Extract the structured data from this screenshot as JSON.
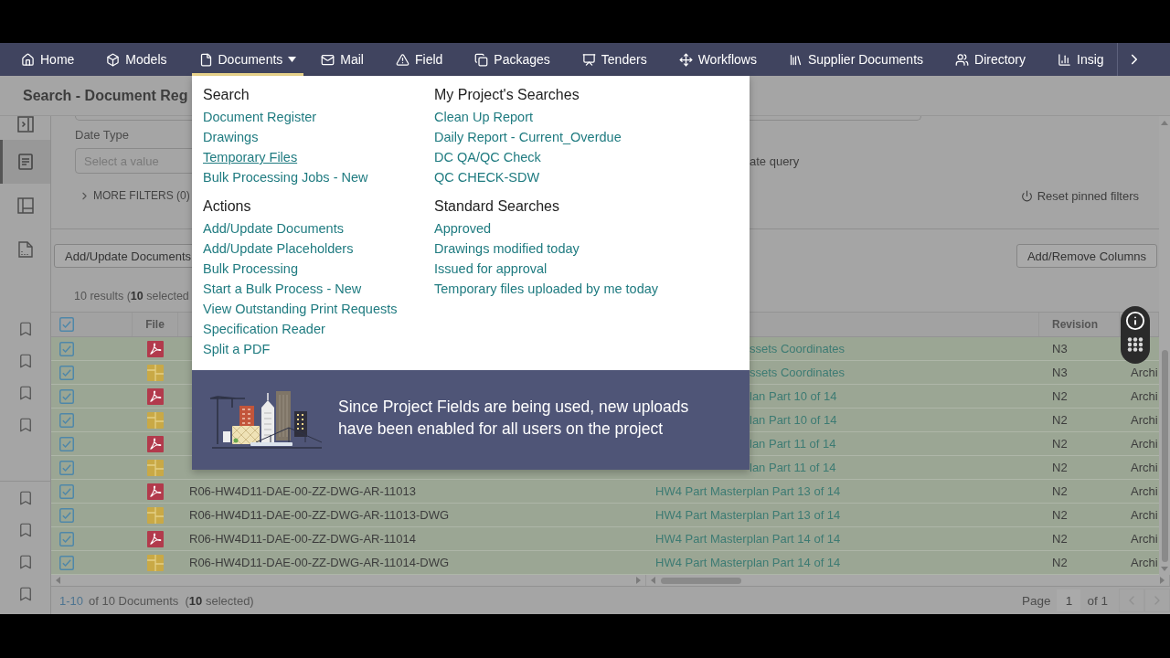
{
  "nav": {
    "items": [
      {
        "label": "Home",
        "selected": false,
        "dropdown": false
      },
      {
        "label": "Models",
        "selected": false,
        "dropdown": false
      },
      {
        "label": "Documents",
        "selected": true,
        "dropdown": true
      },
      {
        "label": "Mail",
        "selected": false,
        "dropdown": false
      },
      {
        "label": "Field",
        "selected": false,
        "dropdown": false
      },
      {
        "label": "Packages",
        "selected": false,
        "dropdown": false
      },
      {
        "label": "Tenders",
        "selected": false,
        "dropdown": false
      },
      {
        "label": "Workflows",
        "selected": false,
        "dropdown": false
      },
      {
        "label": "Supplier Documents",
        "selected": false,
        "dropdown": false
      },
      {
        "label": "Directory",
        "selected": false,
        "dropdown": false
      },
      {
        "label": "Insig",
        "selected": false,
        "dropdown": false
      }
    ]
  },
  "page_title": "Search - Document Reg",
  "sidebar": {
    "tools": [
      {
        "selected": true
      },
      {
        "selected": false
      },
      {
        "selected": false
      }
    ]
  },
  "filters": {
    "date_type": {
      "label": "Date Type",
      "placeholder": "Select a value"
    },
    "query_text": "ate query",
    "more_filters": {
      "label": "MORE FILTERS (0)",
      "expanded": false
    },
    "reset_button": "Reset pinned filters"
  },
  "toolbar": {
    "add_update_button": "Add/Update Documents",
    "columns_button": "Add/Remove Columns"
  },
  "results_summary": "10 results (**10** selected",
  "table": {
    "select_all": {
      "checked": true
    },
    "file_header": "File",
    "revision_header": "Revision",
    "rows": [
      {
        "selected": true,
        "kind": "pdf",
        "title": "ssets Coordinates",
        "revision": "N3"
      },
      {
        "selected": true,
        "kind": "dwg",
        "title": "ssets Coordinates",
        "revision": "N3",
        "discipline": "Archi"
      },
      {
        "selected": true,
        "kind": "pdf",
        "title": "lan Part 10 of 14",
        "revision": "N2",
        "discipline": "Archi"
      },
      {
        "selected": true,
        "kind": "dwg",
        "title": "lan Part 10 of 14",
        "revision": "N2",
        "discipline": "Archi"
      },
      {
        "selected": true,
        "kind": "pdf",
        "title": "lan Part 11 of 14",
        "revision": "N2",
        "discipline": "Archi"
      },
      {
        "selected": true,
        "kind": "dwg",
        "title": "lan Part 11 of 14",
        "revision": "N2",
        "discipline": "Archi"
      },
      {
        "selected": true,
        "kind": "pdf",
        "name": "R06-HW4D11-DAE-00-ZZ-DWG-AR-11013",
        "title": "HW4 Part Masterplan Part 13 of 14",
        "revision": "N2",
        "discipline": "Archi"
      },
      {
        "selected": true,
        "kind": "dwg",
        "name": "R06-HW4D11-DAE-00-ZZ-DWG-AR-11013-DWG",
        "title": "HW4 Part Masterplan Part 13 of 14",
        "revision": "N2",
        "discipline": "Archi"
      },
      {
        "selected": true,
        "kind": "pdf",
        "name": "R06-HW4D11-DAE-00-ZZ-DWG-AR-11014",
        "title": "HW4 Part Masterplan Part 14 of 14",
        "revision": "N2",
        "discipline": "Archi"
      },
      {
        "selected": true,
        "kind": "dwg",
        "name": "R06-HW4D11-DAE-00-ZZ-DWG-AR-11014-DWG",
        "title": "HW4 Part Masterplan Part 14 of 14",
        "revision": "N2",
        "discipline": "Archi"
      }
    ]
  },
  "footer": {
    "range": "1-10",
    "summary": "of 10 Documents  (**10** selected)",
    "page_label": "Page",
    "page": "1",
    "page_total": "of 1",
    "prev_disabled": true,
    "next_disabled": true
  },
  "documents_menu": {
    "columns": [
      {
        "sections": [
          {
            "heading": "Search",
            "links": [
              {
                "label": "Document Register",
                "hovered": false
              },
              {
                "label": "Drawings",
                "hovered": false
              },
              {
                "label": "Temporary Files",
                "hovered": true
              },
              {
                "label": "Bulk Processing Jobs - New",
                "hovered": false
              }
            ]
          },
          {
            "heading": "Actions",
            "links": [
              {
                "label": "Add/Update Documents",
                "hovered": false
              },
              {
                "label": "Add/Update Placeholders",
                "hovered": false
              },
              {
                "label": "Bulk Processing",
                "hovered": false
              },
              {
                "label": "Start a Bulk Process - New",
                "hovered": false
              },
              {
                "label": "View Outstanding Print Requests",
                "hovered": false
              },
              {
                "label": "Specification Reader",
                "hovered": false
              },
              {
                "label": "Split a PDF",
                "hovered": false
              }
            ]
          }
        ]
      },
      {
        "sections": [
          {
            "heading": "My Project's Searches",
            "links": [
              {
                "label": "Clean Up Report",
                "hovered": false
              },
              {
                "label": "Daily Report - Current_Overdue",
                "hovered": false
              },
              {
                "label": "DC QA/QC Check",
                "hovered": false
              },
              {
                "label": "QC CHECK-SDW",
                "hovered": false
              }
            ]
          },
          {
            "heading": "Standard Searches",
            "links": [
              {
                "label": "Approved",
                "hovered": false
              },
              {
                "label": "Drawings modified today",
                "hovered": false
              },
              {
                "label": "Issued for approval",
                "hovered": false
              },
              {
                "label": "Temporary files uploaded by me today",
                "hovered": false
              }
            ]
          }
        ]
      }
    ]
  },
  "banner": {
    "message": "Since Project Fields are being used, new uploads have been enabled for all users on the project"
  }
}
